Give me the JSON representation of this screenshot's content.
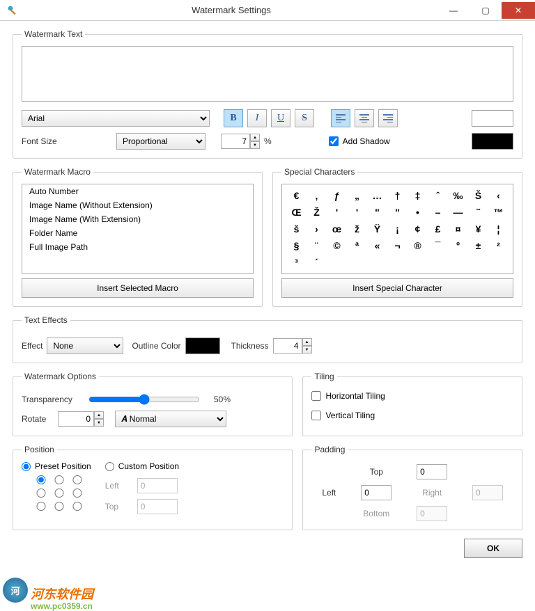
{
  "window": {
    "title": "Watermark Settings"
  },
  "wmtext": {
    "legend": "Watermark Text",
    "font": "Arial",
    "fontsize_label": "Font Size",
    "fontsize_mode": "Proportional",
    "fontsize_value": "7",
    "percent": "%",
    "add_shadow": "Add Shadow"
  },
  "macro": {
    "legend": "Watermark Macro",
    "items": [
      "Auto Number",
      "Image Name (Without Extension)",
      "Image Name (With Extension)",
      "Folder Name",
      "Full Image Path"
    ],
    "insert": "Insert Selected Macro"
  },
  "special": {
    "legend": "Special Characters",
    "chars": [
      "€",
      "‚",
      "ƒ",
      "„",
      "…",
      "†",
      "‡",
      "ˆ",
      "‰",
      "Š",
      "‹",
      "Œ",
      "Ž",
      "'",
      "'",
      "\"",
      "\"",
      "•",
      "–",
      "—",
      "˜",
      "™",
      "š",
      "›",
      "œ",
      "ž",
      "Ÿ",
      "¡",
      "¢",
      "£",
      "¤",
      "¥",
      "¦",
      "§",
      "¨",
      "©",
      "ª",
      "«",
      "¬",
      "®",
      "¯",
      "°",
      "±",
      "²",
      "³",
      "´"
    ],
    "insert": "Insert Special Character"
  },
  "effects": {
    "legend": "Text Effects",
    "effect_label": "Effect",
    "effect_value": "None",
    "outline_label": "Outline Color",
    "thickness_label": "Thickness",
    "thickness_value": "4"
  },
  "options": {
    "legend": "Watermark Options",
    "transparency_label": "Transparency",
    "transparency_value": "50%",
    "rotate_label": "Rotate",
    "rotate_value": "0",
    "orientation": "Normal"
  },
  "tiling": {
    "legend": "Tiling",
    "horizontal": "Horizontal Tiling",
    "vertical": "Vertical Tiling"
  },
  "position": {
    "legend": "Position",
    "preset": "Preset Position",
    "custom": "Custom Position",
    "left_label": "Left",
    "left_value": "0",
    "top_label": "Top",
    "top_value": "0"
  },
  "padding": {
    "legend": "Padding",
    "top_label": "Top",
    "top": "0",
    "left_label": "Left",
    "left": "0",
    "right_label": "Right",
    "right": "0",
    "bottom_label": "Bottom",
    "bottom": "0"
  },
  "ok": "OK",
  "footer": {
    "brand": "河东软件园",
    "url": "www.pc0359.cn"
  }
}
